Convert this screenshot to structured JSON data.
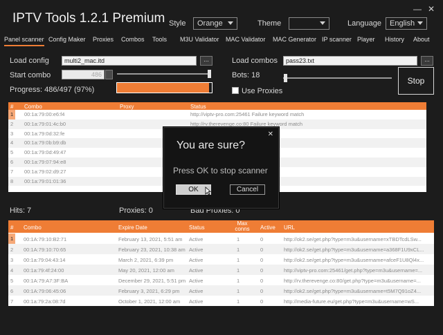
{
  "app": {
    "title": "IPTV Tools 1.2.1 Premium"
  },
  "window_controls": {
    "minimize": "—",
    "close": "✕"
  },
  "header": {
    "style_label": "Style",
    "style_value": "Orange",
    "theme_label": "Theme",
    "theme_value": "",
    "language_label": "Language",
    "language_value": "English"
  },
  "menu": [
    "Panel scanner",
    "Config Maker",
    "Proxies",
    "Combos",
    "Tools",
    "M3U Validator",
    "MAC Validator",
    "MAC Generator",
    "IP scanner",
    "Player",
    "History",
    "About"
  ],
  "form": {
    "load_config_label": "Load config",
    "load_config_value": "multi2_mac.itd",
    "browse": "...",
    "start_combo_label": "Start combo",
    "start_combo_value": "486",
    "progress_label": "Progress: 486/497 (97%)",
    "progress_fraction": 0.97,
    "load_combos_label": "Load combos",
    "load_combos_value": "pass23.txt",
    "bots_label": "Bots: 18",
    "use_proxies_label": "Use Proxies",
    "stop_label": "Stop"
  },
  "scan_table": {
    "headers": [
      "#",
      "Combo",
      "Proxy",
      "Status"
    ],
    "rows": [
      [
        "1",
        "00:1a:79:00:e6:f4",
        "",
        "http://viptv-pro.com:25461 Failure keyword match"
      ],
      [
        "2",
        "00:1a:79:01:4c:b0",
        "",
        "http://rv.therevenge.co:80 Failure keyword match"
      ],
      [
        "3",
        "00:1a:79:0d:32:fe",
        "",
        "http://... Failure keyword match"
      ],
      [
        "4",
        "00:1a:79:0b:b9:db",
        "",
        "http://... Failure keyword match"
      ],
      [
        "5",
        "00:1a:79:0d:49:47",
        "",
        "http://... Failure keyword match"
      ],
      [
        "6",
        "00:1a:79:07:94:e8",
        "",
        "http://... Failure keyword match"
      ],
      [
        "7",
        "00:1a:79:02:d9:27",
        "",
        "http://... Failure keyword match"
      ],
      [
        "8",
        "00:1a:79:01:01:36",
        "",
        "http://... Failure keyword match"
      ]
    ]
  },
  "stats": {
    "hits": "Hits: 7",
    "proxies": "Proxies: 0",
    "bad_proxies": "Bad Proxies: 0"
  },
  "hits_table": {
    "headers": [
      "#",
      "Combo",
      "Expire Date",
      "Status",
      "Max conns",
      "Active",
      "URL"
    ],
    "rows": [
      [
        "1",
        "00:1A:79:10:B2:71",
        "February 13, 2021, 5:51 am",
        "Active",
        "1",
        "0",
        "http://ok2.se/get.php?type=m3u&username=xTBDTcdLSw..."
      ],
      [
        "2",
        "00:1A:79:10:70:65",
        "February 23, 2021, 10:38 am",
        "Active",
        "1",
        "0",
        "http://ok2.se/get.php?type=m3u&username=a368F1U9xCL..."
      ],
      [
        "3",
        "00:1a:79:04:43:14",
        "March 2, 2021, 6:39 pm",
        "Active",
        "1",
        "0",
        "http://ok2.se/get.php?type=m3u&username=afceF1U8Ql4x..."
      ],
      [
        "4",
        "00:1a:79:4f:24:00",
        "May 20, 2021, 12:00 am",
        "Active",
        "1",
        "0",
        "http://viptv-pro.com:25461/get.php?type=m3u&username=..."
      ],
      [
        "5",
        "00:1A:79:A7:3F:BA",
        "December 29, 2021, 5:51 pm",
        "Active",
        "1",
        "0",
        "http://rv.therevenge.co:80/get.php?type=m3u&username=..."
      ],
      [
        "6",
        "00:1A:79:06:45:06",
        "February 3, 2021, 6:29 pm",
        "Active",
        "1",
        "0",
        "http://ok2.se/get.php?type=m3u&username=t5M7Q91oZ4..."
      ],
      [
        "7",
        "00:1a:79:2a:08:7d",
        "October 1, 2021, 12:00 am",
        "Active",
        "1",
        "0",
        "http://media-future.eu/get.php?type=m3u&username=wS..."
      ]
    ]
  },
  "dialog": {
    "title": "You are sure?",
    "message": "Press OK to stop scanner",
    "ok": "OK",
    "cancel": "Cancel",
    "close": "✕"
  },
  "colors": {
    "accent": "#ef7d35",
    "background": "#1c1c1c",
    "selected_row": "#f6a978"
  }
}
